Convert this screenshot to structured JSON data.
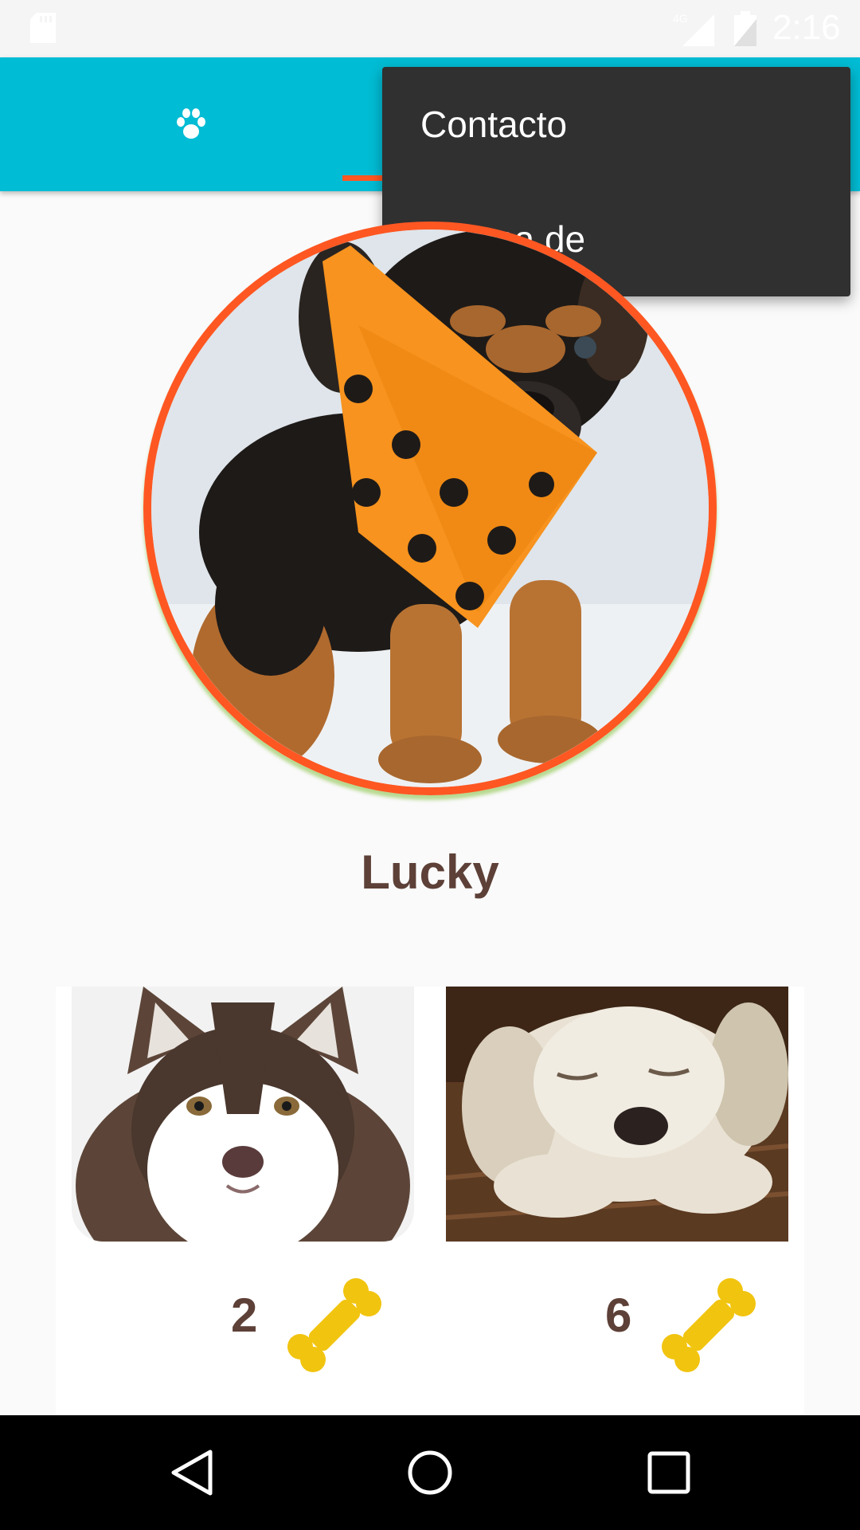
{
  "status_bar": {
    "time": "2:16",
    "icons": [
      "sd-card-icon",
      "network-4g-icon",
      "battery-icon"
    ]
  },
  "app_bar": {
    "background": "#00bcd4",
    "indicator_color": "#ff5722",
    "tabs": [
      {
        "icon": "paw-icon"
      },
      {
        "icon": "profile-tab-icon"
      }
    ]
  },
  "overflow_menu": {
    "items": [
      "Contacto",
      "Acerca de"
    ]
  },
  "profile": {
    "name": "Lucky",
    "photo": "puppy-with-orange-bandana-photo",
    "border_color": "#ff5722"
  },
  "cards": [
    {
      "photo": "husky-photo",
      "likes": "2",
      "icon": "bone-icon"
    },
    {
      "photo": "sleeping-puppy-photo",
      "likes": "6",
      "icon": "bone-icon"
    }
  ],
  "nav_bar": {
    "buttons": [
      "back-icon",
      "home-icon",
      "recents-icon"
    ]
  }
}
